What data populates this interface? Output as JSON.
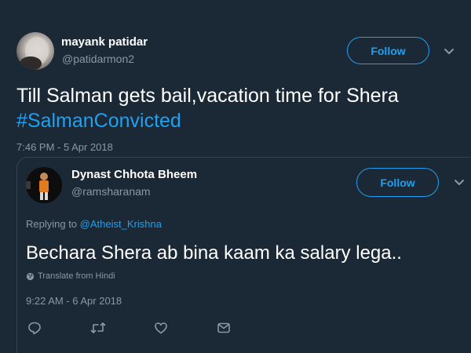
{
  "tweet": {
    "author_name": "mayank patidar",
    "author_handle": "@patidarmon2",
    "follow_label": "Follow",
    "text_line1": "Till Salman gets bail,vacation time for Shera",
    "hashtag": "#SalmanConvicted",
    "timestamp": "7:46 PM - 5 Apr 2018",
    "menu_icon": "chevron-down-icon"
  },
  "reply": {
    "author_name": "Dynast Chhota Bheem",
    "author_handle": "@ramsharanam",
    "follow_label": "Follow",
    "replying_to_prefix": "Replying to",
    "replying_to_handle": "@Atheist_Krishna",
    "text": "Bechara Shera ab bina kaam ka salary lega..",
    "translate_label": "Translate from Hindi",
    "timestamp": "9:22 AM - 6 Apr 2018",
    "menu_icon": "chevron-down-icon",
    "actions": [
      "reply-icon",
      "retweet-icon",
      "like-icon",
      "direct-message-icon"
    ]
  },
  "colors": {
    "background": "#1b2836",
    "accent": "#1da1f2",
    "secondary_text": "#8899a6",
    "divider": "#38444d"
  }
}
